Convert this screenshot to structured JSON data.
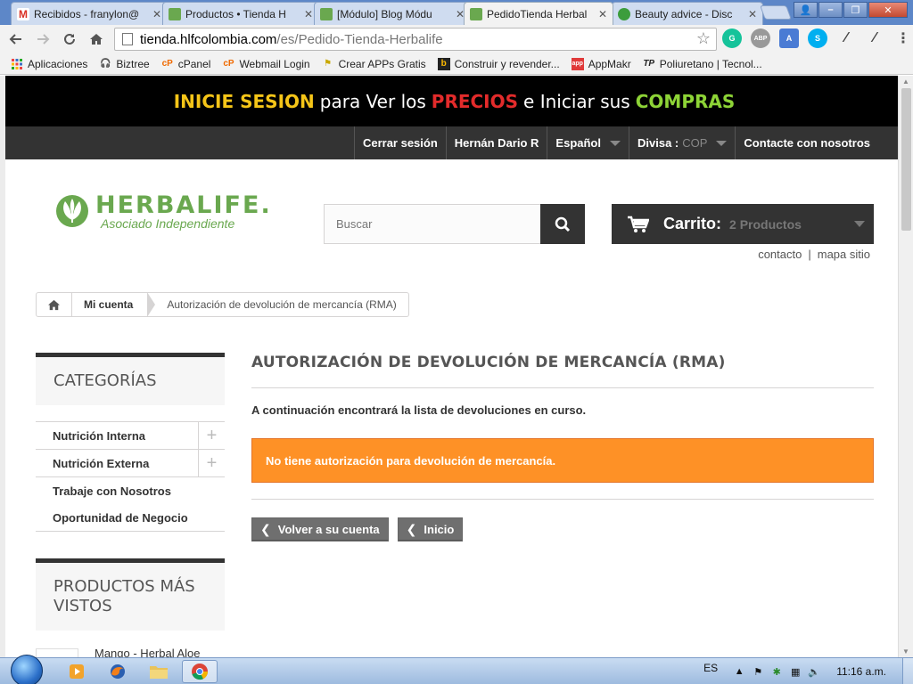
{
  "browser": {
    "tabs": [
      {
        "label": "Recibidos - franylon@",
        "favicon_color": "#d93025",
        "favicon": "M"
      },
      {
        "label": "Productos • Tienda H",
        "favicon_color": "#6aa84f",
        "favicon": ""
      },
      {
        "label": "[Módulo] Blog Módu",
        "favicon_color": "#6aa84f",
        "favicon": ""
      },
      {
        "label": "PedidoTienda Herbal",
        "favicon_color": "#6aa84f",
        "favicon": ""
      },
      {
        "label": "Beauty advice - Disc",
        "favicon_color": "#3c9d3c",
        "favicon": ""
      }
    ],
    "active_tab_index": 3,
    "url_host": "tienda.hlfcolombia.com",
    "url_path": "/es/Pedido-Tienda-Herbalife",
    "extensions": [
      {
        "name": "grammarly-icon",
        "color": "#15c39a",
        "text": "G"
      },
      {
        "name": "adblock-icon",
        "color": "#999999",
        "text": "ABP"
      },
      {
        "name": "translate-icon",
        "color": "#4a7bd4",
        "text": "A"
      },
      {
        "name": "skype-icon",
        "color": "#00aff0",
        "text": "S"
      },
      {
        "name": "eyedropper-icon",
        "color": "#555555",
        "text": "/"
      },
      {
        "name": "colorpicker-icon",
        "color": "#666666",
        "text": "/"
      }
    ],
    "bookmarks": [
      {
        "label": "Aplicaciones",
        "icon": "apps-icon",
        "color": "#e44"
      },
      {
        "label": "Biztree",
        "icon": "biztree-icon",
        "color": "#3a6fc4"
      },
      {
        "label": "cPanel",
        "icon": "cpanel-icon",
        "color": "#f06a00"
      },
      {
        "label": "Webmail Login",
        "icon": "cpanel-icon",
        "color": "#f06a00"
      },
      {
        "label": "Crear APPs Gratis",
        "icon": "flag-icon",
        "color": "#c9a800"
      },
      {
        "label": "Construir y revender...",
        "icon": "builder-icon",
        "color": "#222"
      },
      {
        "label": "AppMakr",
        "icon": "appmakr-icon",
        "color": "#e03a3a"
      },
      {
        "label": "Poliuretano | Tecnol...",
        "icon": "tp-icon",
        "color": "#222"
      }
    ]
  },
  "promo": {
    "part1": "INICIE SESION",
    "part2": "para Ver los",
    "part3": "PRECIOS",
    "part4": "e Iniciar sus",
    "part5": "COMPRAS"
  },
  "topnav": {
    "logout": "Cerrar sesión",
    "user": "Hernán Dario R",
    "language": "Español",
    "currency_label": "Divisa :",
    "currency_value": "COP",
    "contact": "Contacte con nosotros"
  },
  "header": {
    "brand": "HERBALIFE.",
    "brand_sub": "Asociado Independiente",
    "search_placeholder": "Buscar",
    "cart_label": "Carrito:",
    "cart_count": "2 Productos",
    "link_contact": "contacto",
    "link_sep": "|",
    "link_sitemap": "mapa sitio",
    "brand_color": "#6aa84f"
  },
  "breadcrumb": {
    "account": "Mi cuenta",
    "current": "Autorización de devolución de mercancía (RMA)"
  },
  "sidebar": {
    "categories_title": "CATEGORÍAS",
    "categories": [
      {
        "label": "Nutrición Interna",
        "expandable": true
      },
      {
        "label": "Nutrición Externa",
        "expandable": true
      },
      {
        "label": "Trabaje con Nosotros",
        "expandable": false
      },
      {
        "label": "Oportunidad de Negocio",
        "expandable": false
      }
    ],
    "viewed_title": "PRODUCTOS MÁS VISTOS",
    "viewed_first": "Mango - Herbal Aloe"
  },
  "main": {
    "heading": "AUTORIZACIÓN DE DEVOLUCIÓN DE MERCANCÍA (RMA)",
    "intro": "A continuación encontrará la lista de devoluciones en curso.",
    "alert": "No tiene autorización para devolución de mercancía.",
    "alert_color": "#fe9126",
    "btn_back": "Volver a su cuenta",
    "btn_home": "Inicio"
  },
  "taskbar": {
    "lang": "ES",
    "clock": "11:16 a.m."
  }
}
